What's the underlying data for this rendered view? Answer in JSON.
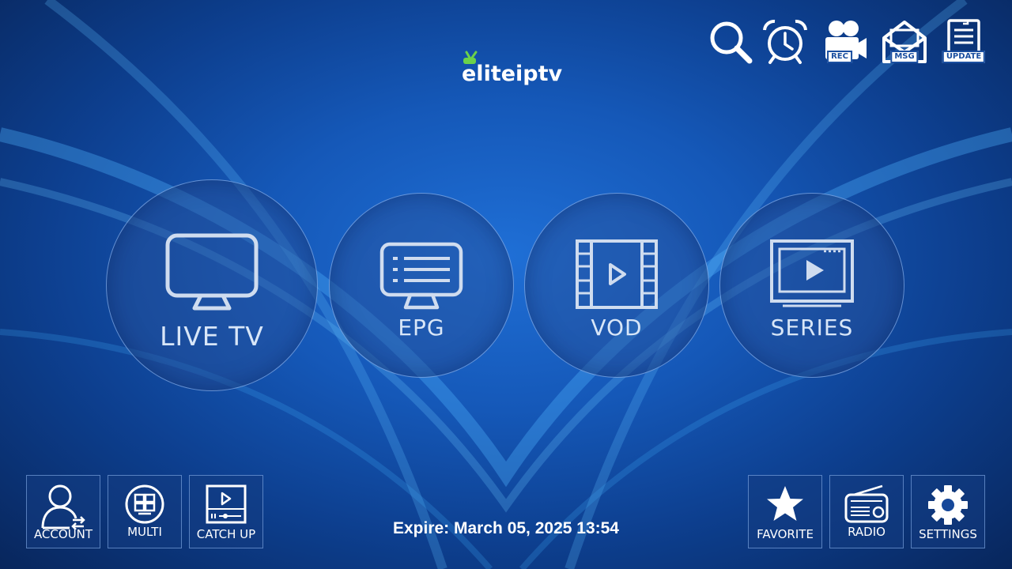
{
  "app": {
    "logo_text": "eliteiptv"
  },
  "top_bar": {
    "search": {
      "label": ""
    },
    "alarm": {
      "label": ""
    },
    "rec": {
      "label": "REC"
    },
    "msg": {
      "label": "MSG"
    },
    "update": {
      "label": "UPDATE"
    }
  },
  "main_menu": {
    "live_tv": "LIVE TV",
    "epg": "EPG",
    "vod": "VOD",
    "series": "SERIES"
  },
  "bottom_left": {
    "account": "ACCOUNT",
    "multi": "MULTI",
    "catch_up": "CATCH UP"
  },
  "bottom_right": {
    "favorite": "FAVORITE",
    "radio": "RADIO",
    "settings": "SETTINGS"
  },
  "status": {
    "expire": "Expire: March 05, 2025 13:54"
  },
  "colors": {
    "background": "#1558b8",
    "accent": "#6bd14a",
    "icon": "#ffffff",
    "circle_text": "#d8e6f8"
  }
}
